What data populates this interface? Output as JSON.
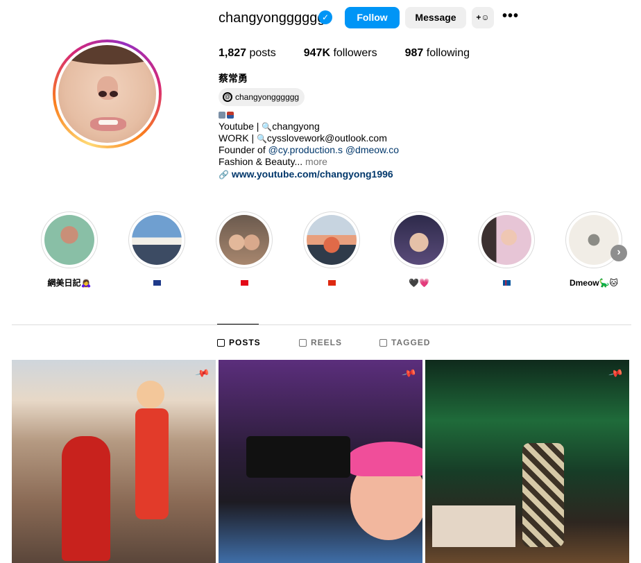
{
  "profile": {
    "username": "changyongggggg",
    "full_name": "蔡常勇",
    "threads_handle": "changyongggggg",
    "follow_label": "Follow",
    "message_label": "Message",
    "add_user_label": "+",
    "more_label": "•••"
  },
  "stats": {
    "posts_count": "1,827",
    "posts_label": "posts",
    "followers_count": "947K",
    "followers_label": "followers",
    "following_count": "987",
    "following_label": "following"
  },
  "bio": {
    "line1_prefix": "Youtube | ",
    "line1_handle": "changyong",
    "line2_prefix": "WORK | ",
    "line2_email": "cysslovework@outlook.com",
    "line3_prefix": "Founder of ",
    "line3_mention1": "@cy.production.s",
    "line3_mention2": "@dmeow.co",
    "line4_text": "Fashion & Beauty...",
    "line4_more": "more",
    "link": "www.youtube.com/changyong1996"
  },
  "highlights": [
    {
      "label": "網美日記🙇‍♀️"
    },
    {
      "label": ""
    },
    {
      "label": ""
    },
    {
      "label": ""
    },
    {
      "label": "🖤💗"
    },
    {
      "label": ""
    },
    {
      "label": "Dmeow🦕🐱"
    }
  ],
  "tabs": {
    "posts": "POSTS",
    "reels": "REELS",
    "tagged": "TAGGED"
  },
  "colors": {
    "accent": "#0095f6",
    "link": "#00376b",
    "muted": "#737373",
    "button_bg": "#efefef"
  },
  "icons": {
    "verified": "verified-badge-icon",
    "threads": "threads-icon",
    "pin": "pin-icon",
    "grid": "grid-icon",
    "reels": "reels-icon",
    "tagged": "tagged-icon",
    "link": "link-icon",
    "next": "chevron-right-icon"
  }
}
